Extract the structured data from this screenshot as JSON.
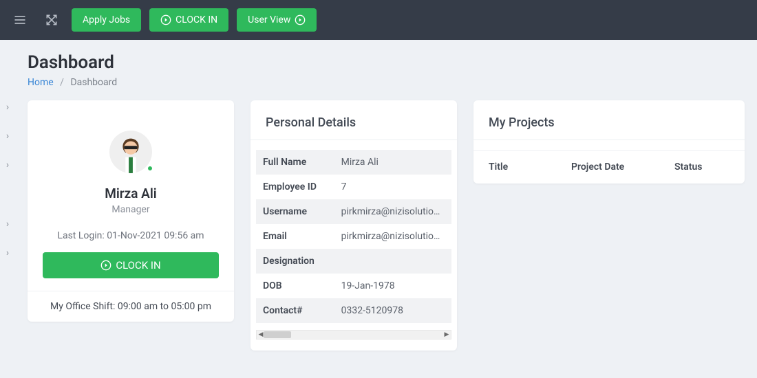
{
  "topbar": {
    "apply_jobs": "Apply Jobs",
    "clock_in_top": "CLOCK IN",
    "user_view": "User View"
  },
  "page": {
    "title": "Dashboard",
    "breadcrumb_home": "Home",
    "breadcrumb_current": "Dashboard"
  },
  "profile": {
    "name": "Mirza Ali",
    "role": "Manager",
    "last_login_label": "Last Login: ",
    "last_login_value": "01-Nov-2021 09:56 am",
    "clock_in_btn": "CLOCK IN",
    "shift_label": "My Office Shift: ",
    "shift_value": "09:00 am to 05:00 pm"
  },
  "details": {
    "title": "Personal Details",
    "rows": [
      {
        "label": "Full Name",
        "value": "Mirza Ali"
      },
      {
        "label": "Employee ID",
        "value": "7"
      },
      {
        "label": "Username",
        "value": "pirkmirza@nizisolutions.com"
      },
      {
        "label": "Email",
        "value": "pirkmirza@nizisolutions.com"
      },
      {
        "label": "Designation",
        "value": ""
      },
      {
        "label": "DOB",
        "value": "19-Jan-1978"
      },
      {
        "label": "Contact#",
        "value": "0332-5120978"
      }
    ]
  },
  "projects": {
    "title": "My Projects",
    "columns": {
      "title": "Title",
      "date": "Project Date",
      "status": "Status"
    }
  },
  "colors": {
    "accent": "#2fb95c",
    "topbar": "#353c48"
  }
}
